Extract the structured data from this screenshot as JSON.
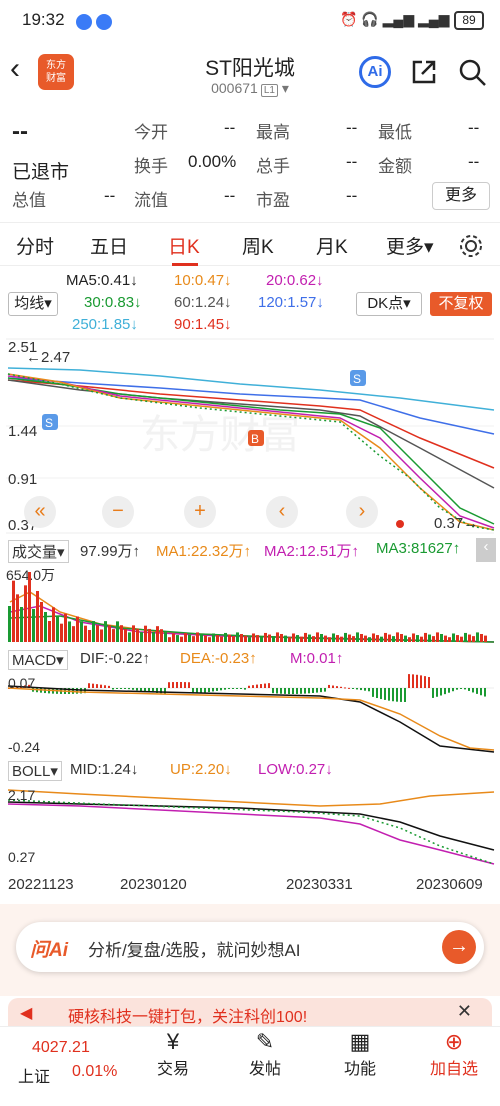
{
  "status": {
    "time": "19:32",
    "battery": "89"
  },
  "header": {
    "logo": "东方\n财富",
    "title": "ST阳光城",
    "code": "000671",
    "badge": "L1",
    "ai": "Ai"
  },
  "quote": {
    "price": "--",
    "state": "已退市",
    "r1": [
      "今开",
      "--",
      "最高",
      "--",
      "最低",
      "--"
    ],
    "r2": [
      "换手",
      "0.00%",
      "总手",
      "--",
      "金额",
      "--"
    ],
    "r3": [
      "总值",
      "--",
      "流值",
      "--",
      "市盈",
      "--"
    ],
    "more": "更多"
  },
  "tabs": [
    "分时",
    "五日",
    "日K",
    "周K",
    "月K",
    "更多"
  ],
  "ma": {
    "ma5": "MA5:0.41",
    "m10": "10:0.47",
    "m20": "20:0.62",
    "m30": "30:0.83",
    "m60": "60:1.24",
    "m120": "120:1.57",
    "m250": "250:1.85",
    "m90": "90:1.45",
    "jx": "均线",
    "dk": "DK点",
    "fq": "不复权"
  },
  "main_chart": {
    "y_labels": [
      "2.51",
      "1.44",
      "0.91",
      "0.37"
    ],
    "max_label": "←2.47",
    "min_label": "0.37→",
    "s_marker": "S",
    "b_marker": "B"
  },
  "volume": {
    "label": "成交量",
    "v": "97.99万",
    "ma1": "MA1:22.32万",
    "ma2": "MA2:12.51万",
    "ma3": "MA3:81627",
    "ymax": "654.0万"
  },
  "macd": {
    "label": "MACD",
    "dif": "DIF:-0.22",
    "dea": "DEA:-0.23",
    "m": "M:0.01",
    "top": "0.07",
    "bottom": "-0.24"
  },
  "boll": {
    "label": "BOLL",
    "mid": "MID:1.24",
    "up": "UP:2.20",
    "low": "LOW:0.27",
    "top": "2.17",
    "bottom": "0.27"
  },
  "dates": [
    "20221123",
    "20230120",
    "20230331",
    "20230609"
  ],
  "ai_bar": {
    "brand": "问Ai",
    "text": "分析/复盘/选股，就问妙想AI"
  },
  "promo": "硬核科技一键打包，关注科创100!",
  "bottom": {
    "index_value": "4027.21",
    "index_name": "上证",
    "index_change": "0.01%",
    "items": [
      "交易",
      "发帖",
      "功能",
      "加自选"
    ]
  },
  "colors": {
    "red": "#e0301e",
    "green": "#1a9a32",
    "orange": "#e88a1a",
    "purple": "#c21fb0",
    "blue": "#3f6fe8",
    "teal": "#40b0d8",
    "ma5": "#222222"
  }
}
